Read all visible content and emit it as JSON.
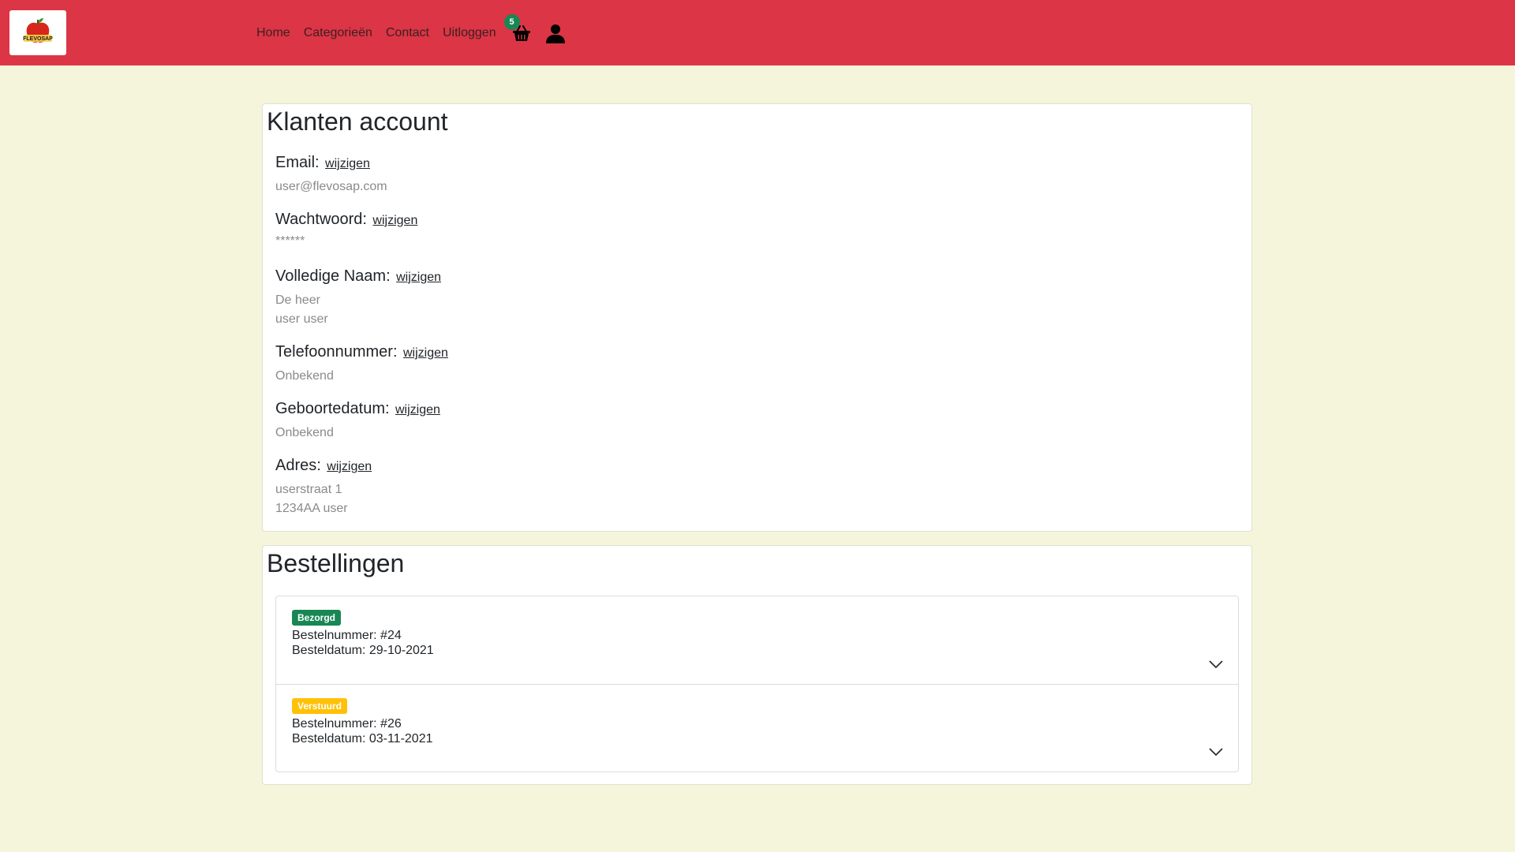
{
  "nav": {
    "logo_text": "FLEVOSAP",
    "links": [
      "Home",
      "Categorieën",
      "Contact",
      "Uitloggen"
    ],
    "cart_count": "5",
    "cart_icon": "basket-icon",
    "user_icon": "user-icon"
  },
  "account": {
    "title": "Klanten account",
    "edit_label": "wijzigen",
    "email": {
      "label": "Email:",
      "value": "user@flevosap.com"
    },
    "password": {
      "label": "Wachtwoord:",
      "value": "******"
    },
    "fullname": {
      "label": "Volledige Naam:",
      "salutation": "De heer",
      "value": "user user"
    },
    "phone": {
      "label": "Telefoonnummer:",
      "value": "Onbekend"
    },
    "birthdate": {
      "label": "Geboortedatum:",
      "value": "Onbekend"
    },
    "address": {
      "label": "Adres:",
      "street": "userstraat 1",
      "city": "1234AA user"
    }
  },
  "orders": {
    "title": "Bestellingen",
    "items": [
      {
        "status": "Bezorgd",
        "status_color": "#198754",
        "number": "Bestelnummer: #24",
        "date": "Besteldatum: 29-10-2021"
      },
      {
        "status": "Verstuurd",
        "status_color": "#ffc107",
        "number": "Bestelnummer: #26",
        "date": "Besteldatum: 03-11-2021"
      }
    ]
  }
}
